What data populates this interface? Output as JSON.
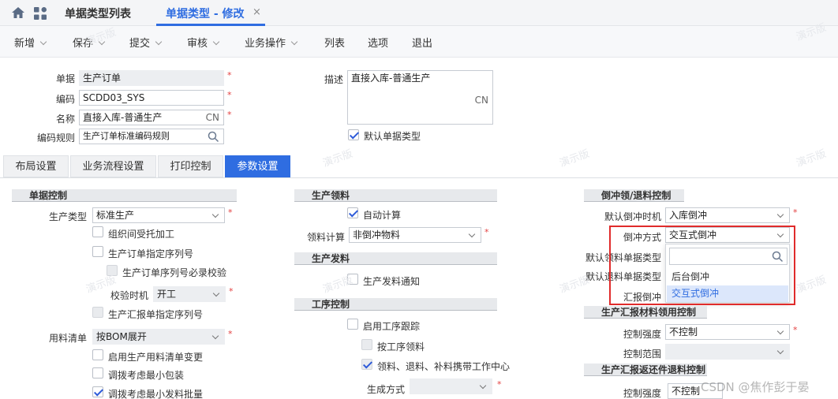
{
  "tabs": [
    {
      "label": "单据类型列表"
    },
    {
      "label": "单据类型 - 修改"
    }
  ],
  "toolbar": {
    "new": "新增",
    "save": "保存",
    "submit": "提交",
    "audit": "审核",
    "business": "业务操作",
    "list": "列表",
    "options": "选项",
    "exit": "退出"
  },
  "header": {
    "bill_label": "单据",
    "bill_value": "生产订单",
    "code_label": "编码",
    "code_value": "SCDD03_SYS",
    "name_label": "名称",
    "name_value": "直接入库-普通生产",
    "name_lang": "CN",
    "rule_label": "编码规则",
    "rule_value": "生产订单标准编码规则",
    "desc_label": "描述",
    "desc_value": "直接入库-普通生产",
    "desc_lang": "CN",
    "default_type_label": "默认单据类型"
  },
  "ptabs": [
    "布局设置",
    "业务流程设置",
    "打印控制",
    "参数设置"
  ],
  "col1": {
    "section": "单据控制",
    "prod_type_label": "生产类型",
    "prod_type_value": "标准生产",
    "org_entrust": "组织间受托加工",
    "order_serial": "生产订单指定序列号",
    "serial_required": "生产订单序列号必录校验",
    "check_time_label": "校验时机",
    "check_time_value": "开工",
    "report_serial": "生产汇报单指定序列号",
    "bom_label": "用料清单",
    "bom_value": "按BOM展开",
    "enable_change": "启用生产用料清单变更",
    "min_pack": "调拨考虑最小包装",
    "min_batch": "调拨考虑最小发料批量"
  },
  "col2": {
    "pick_section": "生产领料",
    "auto_calc": "自动计算",
    "pick_calc_label": "领料计算",
    "pick_calc_value": "非倒冲物料",
    "issue_section": "生产发料",
    "issue_notice": "生产发料通知",
    "process_section": "工序控制",
    "enable_track": "启用工序跟踪",
    "by_process": "按工序领料",
    "carry_center": "领料、退料、补料携带工作中心",
    "gen_method_label": "生成方式"
  },
  "col3": {
    "section": "倒冲领/退料控制",
    "default_time_label": "默认倒冲时机",
    "default_time_value": "入库倒冲",
    "method_label": "倒冲方式",
    "method_value": "交互式倒冲",
    "def_pick_label": "默认领料单据类型",
    "def_return_label": "默认退料单据类型",
    "report_back_label": "汇报倒冲",
    "dropdown_options": [
      "后台倒冲",
      "交互式倒冲"
    ],
    "report_pick_section": "生产汇报材料领用控制",
    "ctrl_strength_label": "控制强度",
    "ctrl_strength_value": "不控制",
    "ctrl_range_label": "控制范围",
    "report_return_section": "生产汇报返还件退料控制",
    "ctrl_strength2_label": "控制强度",
    "ctrl_strength2_value": "不控制"
  },
  "watermark": "演示版",
  "csdn_mark": "CSDN @焦作彭于晏",
  "colors": {
    "accent": "#2f6de1",
    "active_tab": "#2f6de1",
    "required": "#e34141",
    "highlight_box": "#e02b2b"
  }
}
